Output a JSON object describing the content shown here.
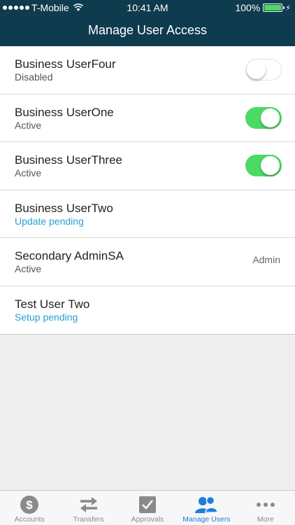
{
  "status_bar": {
    "carrier": "T-Mobile",
    "time": "10:41 AM",
    "battery": "100%",
    "battery_level": 1.0
  },
  "header": {
    "title": "Manage User Access"
  },
  "users": [
    {
      "name": "Business UserFour",
      "status": "Disabled",
      "toggle": "off"
    },
    {
      "name": "Business UserOne",
      "status": "Active",
      "toggle": "on"
    },
    {
      "name": "Business UserThree",
      "status": "Active",
      "toggle": "on"
    },
    {
      "name": "Business UserTwo",
      "status": "Update pending"
    },
    {
      "name": "Secondary AdminSA",
      "status": "Active",
      "role": "Admin"
    },
    {
      "name": "Test User Two",
      "status": "Setup pending"
    }
  ],
  "tabs": [
    {
      "label": "Accounts",
      "icon": "dollar-circle-icon"
    },
    {
      "label": "Transfers",
      "icon": "transfer-arrows-icon"
    },
    {
      "label": "Approvals",
      "icon": "checkbox-icon"
    },
    {
      "label": "Manage Users",
      "icon": "users-icon",
      "active": true
    },
    {
      "label": "More",
      "icon": "ellipsis-icon"
    }
  ],
  "colors": {
    "header_bg": "#0f3b4e",
    "toggle_on": "#4cd964",
    "pending_text": "#2a9fd0",
    "active_tab": "#1a7fd6",
    "inactive_tab": "#8a8a8a"
  }
}
